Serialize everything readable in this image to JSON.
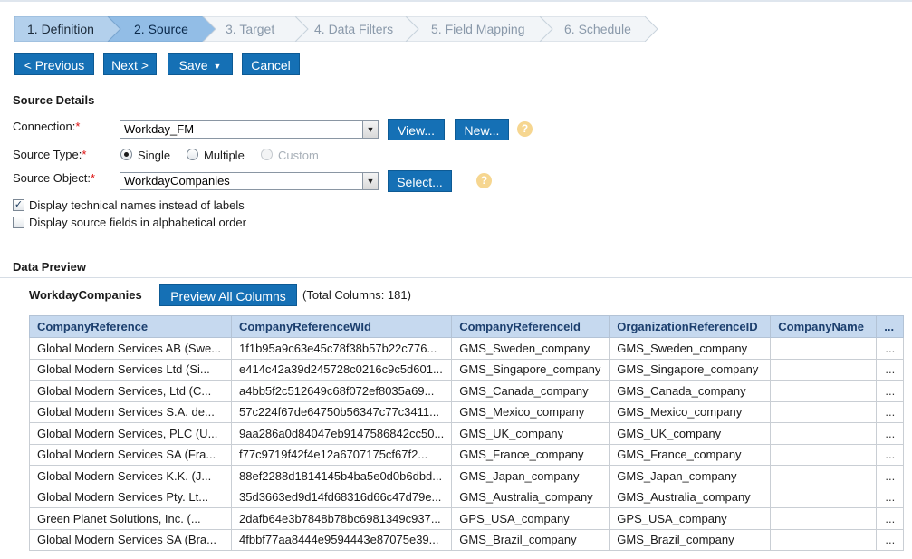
{
  "wizard": {
    "steps": [
      {
        "label": "1. Definition",
        "state": "done"
      },
      {
        "label": "2. Source",
        "state": "active"
      },
      {
        "label": "3. Target",
        "state": "todo"
      },
      {
        "label": "4. Data Filters",
        "state": "todo"
      },
      {
        "label": "5. Field Mapping",
        "state": "todo"
      },
      {
        "label": "6. Schedule",
        "state": "todo"
      }
    ]
  },
  "toolbar": {
    "previous": "< Previous",
    "next": "Next >",
    "save": "Save",
    "cancel": "Cancel"
  },
  "source_details": {
    "title": "Source Details",
    "connection_label": "Connection:",
    "connection_value": "Workday_FM",
    "view_button": "View...",
    "new_button": "New...",
    "source_type_label": "Source Type:",
    "type_single": "Single",
    "type_multiple": "Multiple",
    "type_custom": "Custom",
    "selected_type": "Single",
    "source_object_label": "Source Object:",
    "source_object_value": "WorkdayCompanies",
    "select_button": "Select...",
    "opt_technical_names": "Display technical names instead of labels",
    "opt_technical_checked": true,
    "opt_alphabetical": "Display source fields in alphabetical order",
    "opt_alphabetical_checked": false,
    "required_mark": "*",
    "help_glyph": "?"
  },
  "data_preview": {
    "title": "Data Preview",
    "object_name": "WorkdayCompanies",
    "preview_button": "Preview All Columns",
    "total_columns": "(Total Columns: 181)",
    "columns": [
      "CompanyReference",
      "CompanyReferenceWId",
      "CompanyReferenceId",
      "OrganizationReferenceID",
      "CompanyName",
      "..."
    ],
    "rows": [
      [
        "Global Modern Services AB (Swe...",
        "1f1b95a9c63e45c78f38b57b22c776...",
        "GMS_Sweden_company",
        "GMS_Sweden_company",
        "",
        "..."
      ],
      [
        "Global Modern Services Ltd (Si...",
        "e414c42a39d245728c0216c9c5d601...",
        "GMS_Singapore_company",
        "GMS_Singapore_company",
        "",
        "..."
      ],
      [
        "Global Modern Services, Ltd (C...",
        "a4bb5f2c512649c68f072ef8035a69...",
        "GMS_Canada_company",
        "GMS_Canada_company",
        "",
        "..."
      ],
      [
        "Global Modern Services S.A. de...",
        "57c224f67de64750b56347c77c3411...",
        "GMS_Mexico_company",
        "GMS_Mexico_company",
        "",
        "..."
      ],
      [
        "Global Modern Services, PLC (U...",
        "9aa286a0d84047eb9147586842cc50...",
        "GMS_UK_company",
        "GMS_UK_company",
        "",
        "..."
      ],
      [
        "Global Modern Services SA (Fra...",
        "f77c9719f42f4e12a6707175cf67f2...",
        "GMS_France_company",
        "GMS_France_company",
        "",
        "..."
      ],
      [
        "Global Modern Services K.K. (J...",
        "88ef2288d1814145b4ba5e0d0b6dbd...",
        "GMS_Japan_company",
        "GMS_Japan_company",
        "",
        "..."
      ],
      [
        "Global Modern Services Pty. Lt...",
        "35d3663ed9d14fd68316d66c47d79e...",
        "GMS_Australia_company",
        "GMS_Australia_company",
        "",
        "..."
      ],
      [
        "Green Planet Solutions, Inc. (...",
        "2dafb64e3b7848b78bc6981349c937...",
        "GPS_USA_company",
        "GPS_USA_company",
        "",
        "..."
      ],
      [
        "Global Modern Services SA (Bra...",
        "4fbbf77aa8444e9594443e87075e39...",
        "GMS_Brazil_company",
        "GMS_Brazil_company",
        "",
        "..."
      ]
    ]
  },
  "colors": {
    "button_blue": "#1570b5",
    "step_done": "#b3d0ec",
    "step_active": "#92bde6",
    "step_todo": "#f2f5f8",
    "header_bg": "#c6d9ef",
    "help_orange": "#f6d690"
  }
}
